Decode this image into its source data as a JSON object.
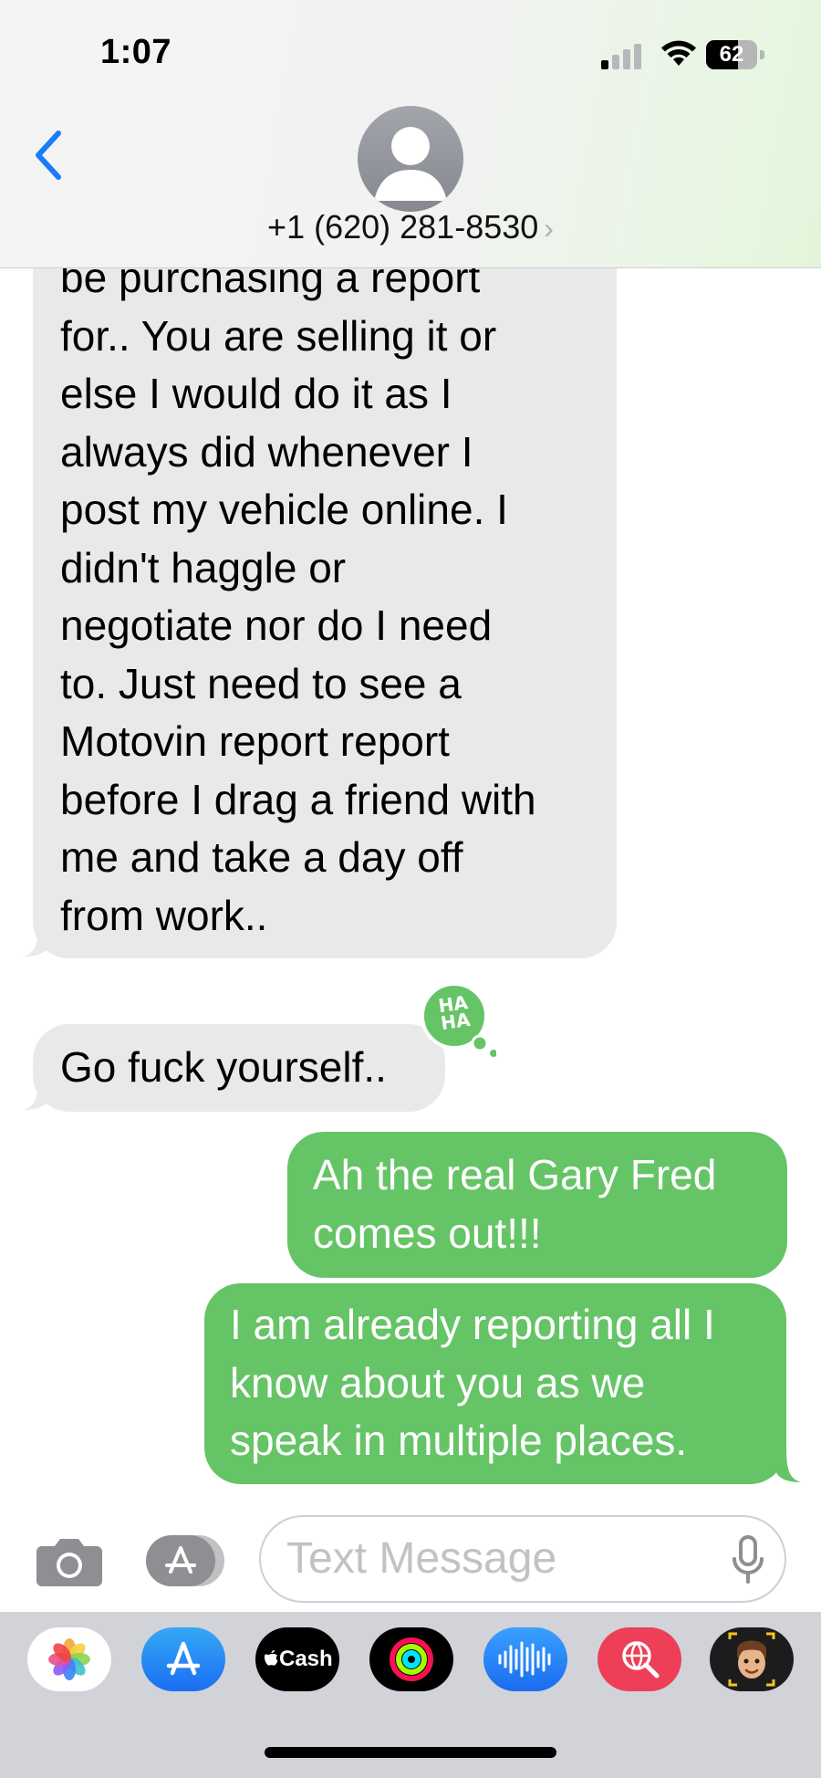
{
  "status_bar": {
    "time": "1:07",
    "battery_level": "62",
    "signal_bars_active": 1,
    "signal_bars_total": 4
  },
  "header": {
    "contact_number": "+1 (620) 281-8530",
    "avatar_icon": "person-silhouette-icon",
    "back_icon": "chevron-left-icon"
  },
  "messages": [
    {
      "sender": "them",
      "lines": [
        "be purchasing a report",
        "for.. You are selling it or",
        "else I would do it as I",
        "always did whenever I",
        "post my vehicle online. I",
        "didn't haggle or",
        "negotiate nor do I need",
        "to. Just need to see a",
        "Motovin report report",
        "before I drag a friend with",
        "me and take a day off",
        "from work.."
      ]
    },
    {
      "sender": "them",
      "lines": [
        "Go fuck yourself.."
      ],
      "tapback": "HA HA",
      "tapback_top": "HA",
      "tapback_bottom": "HA"
    },
    {
      "sender": "me",
      "lines": [
        "Ah the real Gary Fred",
        "comes out!!!"
      ]
    },
    {
      "sender": "me",
      "lines": [
        "I am already reporting all I",
        "know about you as we",
        "speak in multiple places."
      ]
    }
  ],
  "compose": {
    "placeholder": "Text Message",
    "camera_icon": "camera-icon",
    "apps_icon": "app-store-icon",
    "mic_icon": "microphone-icon"
  },
  "app_drawer": [
    {
      "name": "Photos",
      "icon": "photos-icon"
    },
    {
      "name": "App Store",
      "icon": "app-store-icon"
    },
    {
      "name": "Cash",
      "label": "Cash",
      "icon": "apple-cash-icon"
    },
    {
      "name": "Fitness",
      "icon": "activity-rings-icon"
    },
    {
      "name": "Audio",
      "icon": "audio-waveform-icon"
    },
    {
      "name": "Search",
      "icon": "globe-search-icon"
    },
    {
      "name": "Memoji",
      "icon": "memoji-icon"
    }
  ],
  "colors": {
    "sent_bubble": "#65c466",
    "received_bubble": "#e9e9eb",
    "accent_blue": "#1a7cf6"
  }
}
